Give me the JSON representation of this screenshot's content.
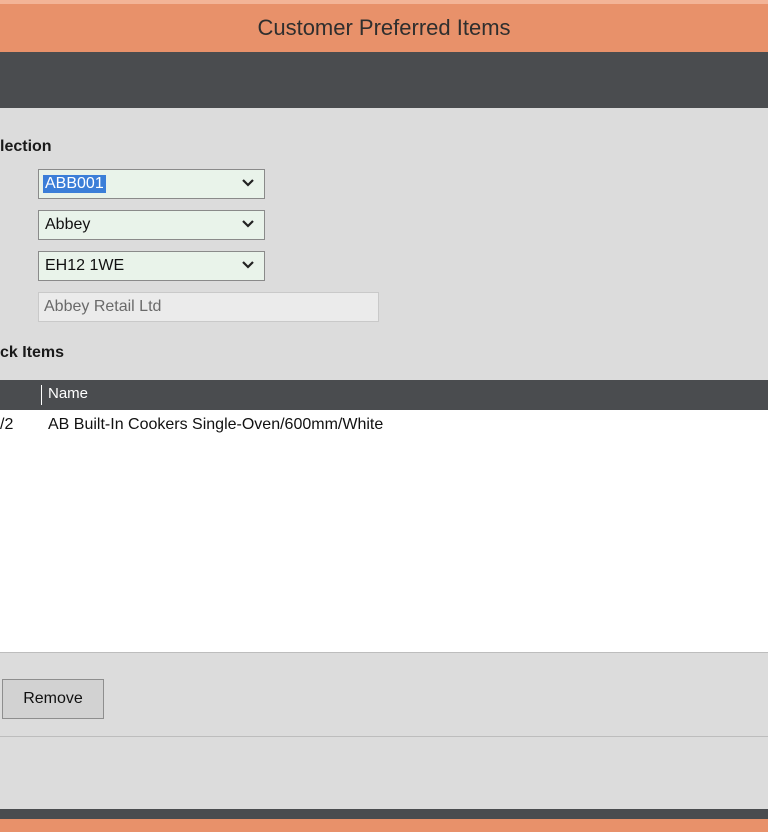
{
  "window": {
    "title": "Customer Preferred Items"
  },
  "selection": {
    "heading": "lection",
    "customer_code": "ABB001",
    "customer_name": "Abbey",
    "postcode": "EH12 1WE",
    "company_name": "Abbey Retail Ltd"
  },
  "stock_items": {
    "heading": "ck Items",
    "columns": {
      "name": "Name"
    },
    "rows": [
      {
        "code": "/2",
        "name": "AB Built-In Cookers Single-Oven/600mm/White"
      }
    ]
  },
  "actions": {
    "remove_label": "Remove"
  },
  "icons": {
    "dropdown": "chevron-down-icon"
  },
  "colors": {
    "title_bar": "#e8916a",
    "dark_bar": "#4a4c4f",
    "panel": "#dcdcdc",
    "select_bg": "#e9f3ea",
    "selection_highlight": "#3b7ed8"
  }
}
